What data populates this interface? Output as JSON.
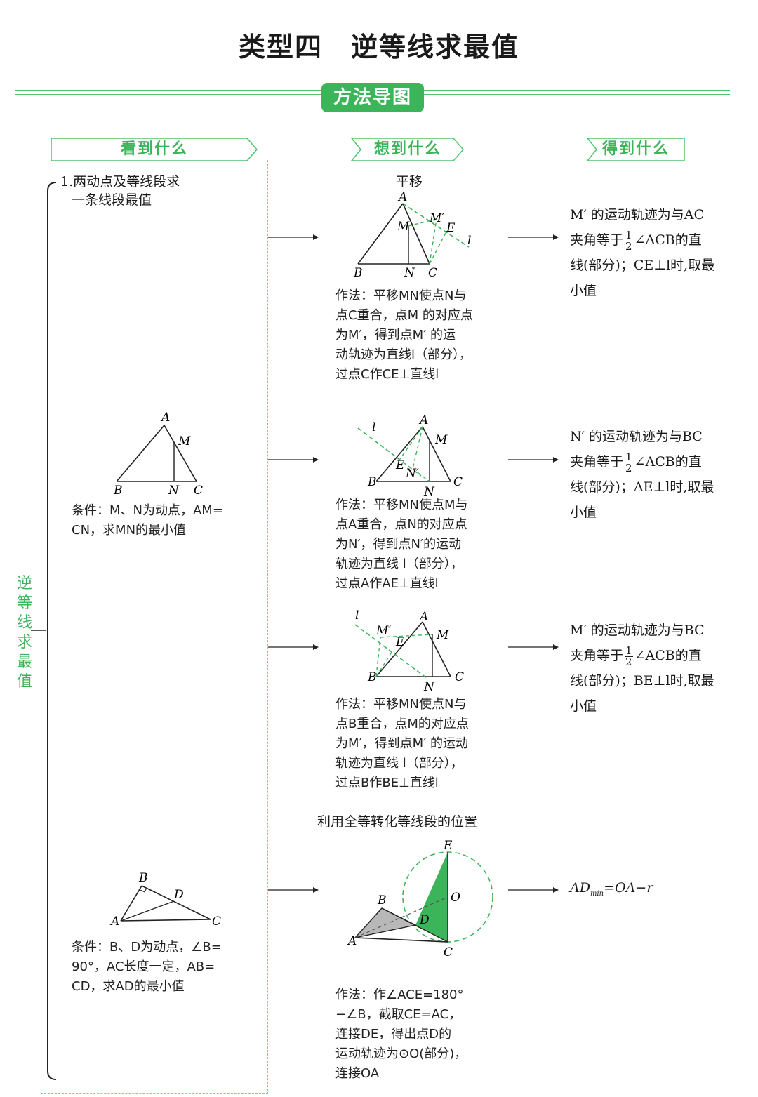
{
  "title": {
    "part1": "类型四",
    "part2": "逆等线求最值"
  },
  "banner": "方法导图",
  "headers": {
    "see": "看到什么",
    "think": "想到什么",
    "get": "得到什么"
  },
  "side_label": "逆等线求最值",
  "rows": [
    {
      "condition_title": "1.两动点及等线段求",
      "condition_title2": "一条线段最值",
      "method_title": "平移",
      "method_lines": [
        "作法：平移MN使点N与",
        "点C重合，点M 的对应点",
        "为M′，得到点M′ 的运",
        "动轨迹为直线l（部分），",
        "过点C作CE⊥直线l"
      ],
      "result_lines": [
        "M′ 的运动轨迹为与AC",
        "夹角等于",
        "∠ACB的直",
        "线(部分)；CE⊥l时,取最",
        "小值"
      ],
      "frac": {
        "num": "1",
        "den": "2"
      }
    },
    {
      "condition_lines": [
        "条件：M、N为动点，AM=",
        "CN，求MN的最小值"
      ],
      "method_lines": [
        "作法：平移MN使点M与",
        "点A重合，点N的对应点",
        "为N′，得到点N′的运动",
        "轨迹为直线 l（部分），",
        "过点A作AE⊥直线l"
      ],
      "result_lines": [
        "N′ 的运动轨迹为与BC",
        "夹角等于",
        "∠ACB的直",
        "线(部分)；AE⊥l时,取最",
        "小值"
      ]
    },
    {
      "method_lines": [
        "作法：平移MN使点N与",
        "点B重合，点M的对应点",
        "为M′，得到点M′ 的运动",
        "轨迹为直线 l（部分），",
        "过点B作BE⊥直线l"
      ],
      "result_lines": [
        "M′ 的运动轨迹为与BC",
        "夹角等于",
        "∠ACB的直",
        "线(部分)；BE⊥l时,取最",
        "小值"
      ]
    },
    {
      "method_title": "利用全等转化等线段的位置",
      "condition_lines": [
        "条件：B、D为动点，∠B=",
        "90°，AC长度一定，AB=",
        "CD，求AD的最小值"
      ],
      "method_lines": [
        "作法：作∠ACE=180°",
        "−∠B，截取CE=AC，",
        "连接DE，得出点D的",
        "运动轨迹为⊙O(部分)，",
        "连接OA"
      ],
      "result_lines": [
        "AD",
        "min",
        "=OA−r"
      ]
    }
  ],
  "figure_labels": {
    "A": "A",
    "B": "B",
    "C": "C",
    "D": "D",
    "E": "E",
    "M": "M",
    "N": "N",
    "O": "O",
    "Mp": "M′",
    "Np": "N′",
    "l": "l"
  },
  "colors": {
    "accent": "#3cb55a",
    "dash": "#52c36a",
    "text": "#1a1a1a",
    "shade": "#b8b8b8"
  }
}
